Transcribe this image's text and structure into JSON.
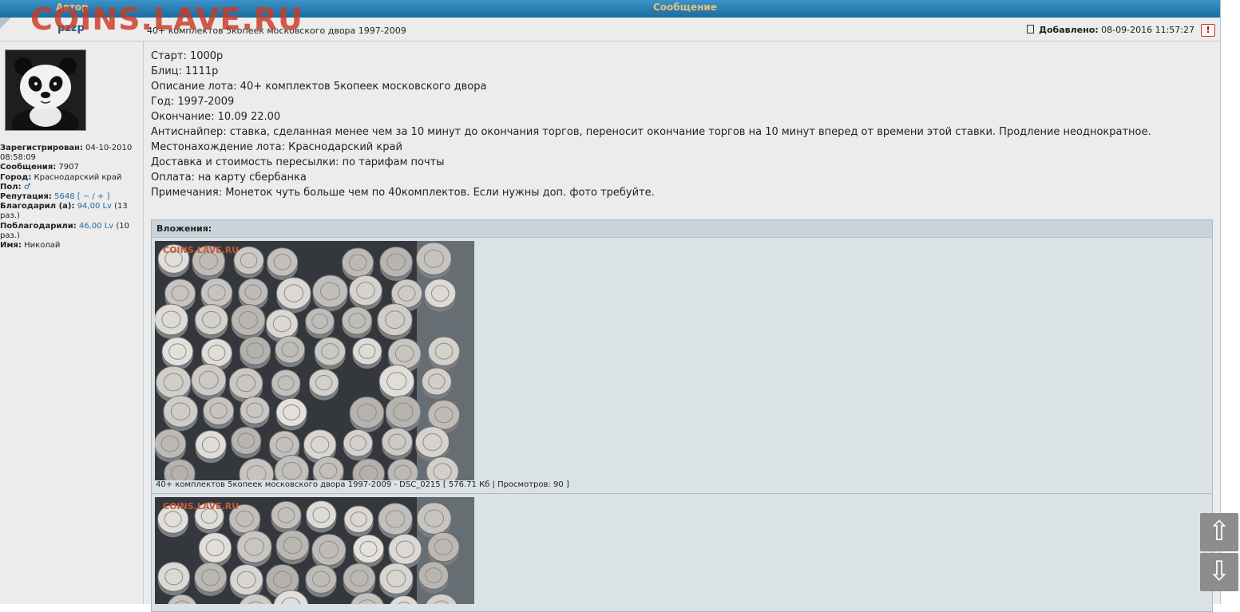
{
  "watermark": "COINS.LAVE.RU",
  "header": {
    "author_col": "Автор",
    "message_col": "Сообщение"
  },
  "post": {
    "username": "pzzp",
    "topic_title": "40+ комплектов 5копеек московского двора 1997-2009",
    "added_label": "Добавлено:",
    "added_value": "08-09-2016 11:57:27",
    "report_icon": "!",
    "lines": [
      "Старт: 1000р",
      "Блиц: 1111р",
      "Описание лота: 40+ комплектов 5копеек московского двора",
      "Год: 1997-2009",
      "Окончание: 10.09 22.00",
      "Антиснайпер: ставка, сделанная менее чем за 10 минут до окончания торгов, переносит окончание торгов на 10 минут вперед от времени этой ставки. Продление неоднократное.",
      "Местонахождение лота: Краснодарский край",
      "Доставка и стоимость пересылки: по тарифам почты",
      "Оплата: на карту сбербанка",
      "Примечания: Монеток чуть больше чем по 40комплектов. Если нужны доп. фото требуйте."
    ]
  },
  "profile": {
    "registered_label": "Зарегистрирован:",
    "registered_value": "04-10-2010 08:58:09",
    "messages_label": "Сообщения:",
    "messages_value": "7907",
    "city_label": "Город:",
    "city_value": "Краснодарский край",
    "gender_label": "Пол:",
    "gender_icon": "♂",
    "reputation_label": "Репутация:",
    "reputation_value": "5648",
    "reputation_controls": "[ − / + ]",
    "thanked_label": "Благодарил (а):",
    "thanked_value": "94,00 Lv",
    "thanked_count": "(13 раз.)",
    "thanked_by_label": "Поблагодарили:",
    "thanked_by_value": "46,00 Lv",
    "thanked_by_count": "(10 раз.)",
    "name_label": "Имя:",
    "name_value": "Николай"
  },
  "attachments": {
    "title": "Вложения:",
    "photo_watermark": "COINS.LAVE.RU",
    "caption_1": "40+ комплектов 5копеек московского двора 1997-2009 - DSC_0215 [ 576.71 Кб | Просмотров: 90 ]"
  },
  "scroll": {
    "up_icon": "⇧",
    "down_icon": "⇩"
  }
}
